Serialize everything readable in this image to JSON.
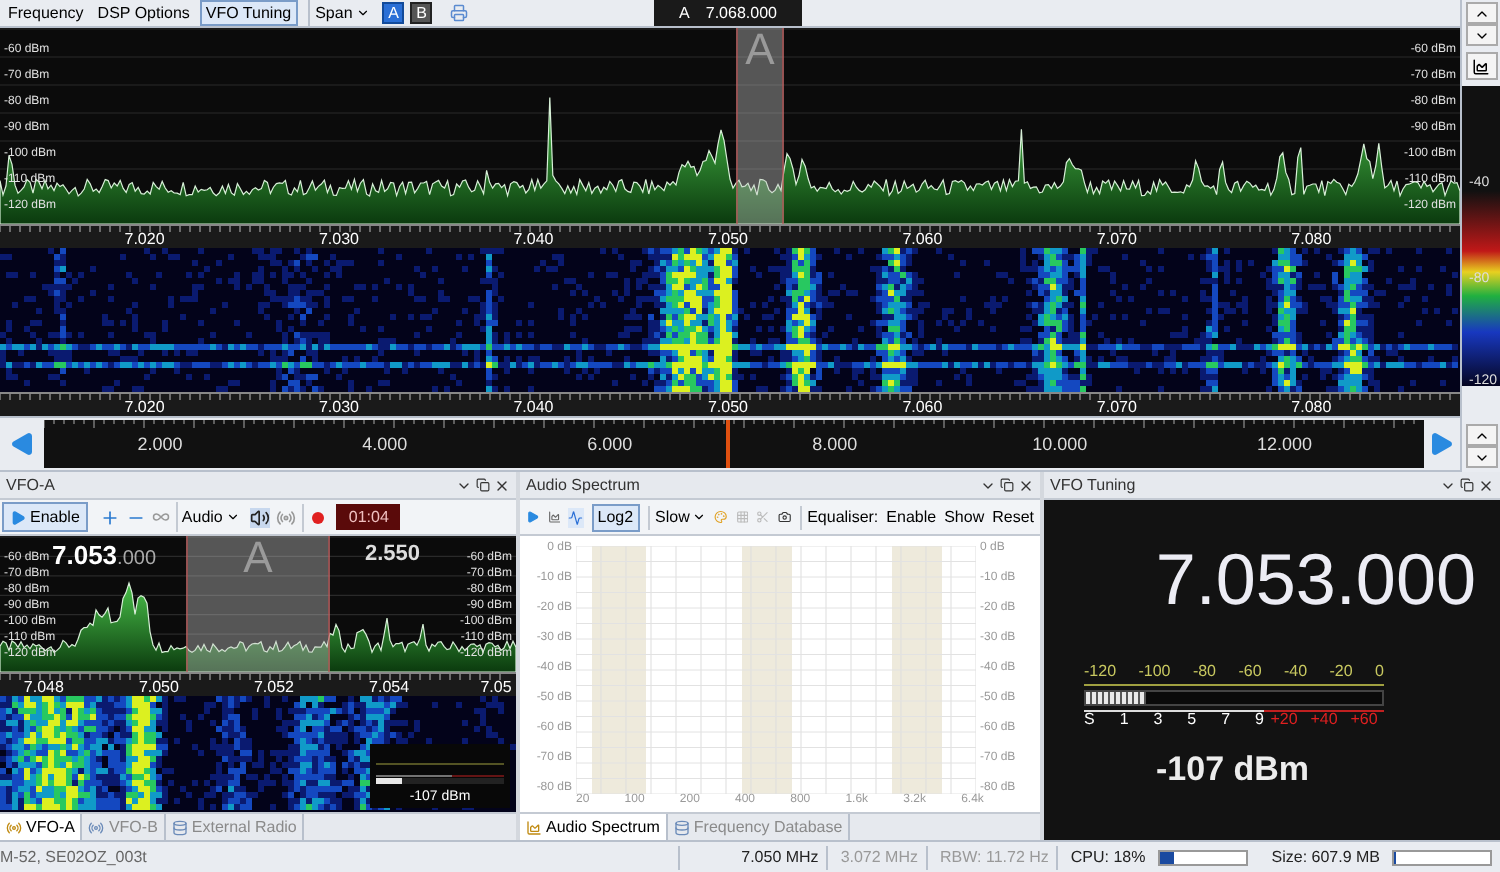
{
  "toolbar": {
    "tabs": [
      {
        "label": "Frequency",
        "selected": false
      },
      {
        "label": "DSP Options",
        "selected": false
      },
      {
        "label": "VFO Tuning",
        "selected": true
      }
    ],
    "span": "Span",
    "vfo_buttons": [
      {
        "label": "A",
        "selected": true
      },
      {
        "label": "B",
        "selected": false
      }
    ],
    "vfo_tab": {
      "vfo": "A",
      "frequency": "7.068.000"
    }
  },
  "spectrum": {
    "marker": "A",
    "dbm_left": [
      "-60 dBm",
      "-70 dBm",
      "-80 dBm",
      "-90 dBm",
      "-100 dBm",
      "-110 dBm",
      "-120 dBm"
    ],
    "dbm_right": [
      "-60 dBm",
      "-70 dBm",
      "-80 dBm",
      "-90 dBm",
      "-100 dBm",
      "-110 dBm",
      "-120 dBm"
    ],
    "freq_labels": [
      "7.020",
      "7.030",
      "7.040",
      "7.050",
      "7.060",
      "7.070",
      "7.080"
    ]
  },
  "waterfall": {
    "freq_labels": [
      "7.020",
      "7.030",
      "7.040",
      "7.050",
      "7.060",
      "7.070",
      "7.080"
    ]
  },
  "colour_scale": {
    "labels": [
      "-40",
      "-80",
      "-120"
    ]
  },
  "span_bar": {
    "labels": [
      "2.000",
      "4.000",
      "6.000",
      "8.000",
      "10.000",
      "12.000"
    ]
  },
  "vfo_a": {
    "title": "VFO-A",
    "enable": "Enable",
    "audio": "Audio",
    "timer": "01:04",
    "frequency": "7.053",
    "frequency_fraction": ".000",
    "bandwidth": "2.550",
    "marker": "A",
    "dbm_left": [
      "-60 dBm",
      "-70 dBm",
      "-80 dBm",
      "-90 dBm",
      "-100 dBm",
      "-110 dBm",
      "-120 dBm"
    ],
    "dbm_right": [
      "-60 dBm",
      "-70 dBm",
      "-80 dBm",
      "-90 dBm",
      "-100 dBm",
      "-110 dBm",
      "-120 dBm"
    ],
    "freq_labels": [
      "7.048",
      "7.050",
      "7.052",
      "7.054",
      "7.05"
    ],
    "meter": {
      "reading": "-107 dBm",
      "level": 0.2
    },
    "tabs": [
      {
        "label": "VFO-A",
        "selected": true
      },
      {
        "label": "VFO-B",
        "selected": false
      },
      {
        "label": "External Radio",
        "selected": false
      }
    ]
  },
  "audio_spectrum": {
    "title": "Audio Spectrum",
    "log": {
      "label": "Log2",
      "selected": true
    },
    "speed": "Slow",
    "equaliser": "Equaliser:",
    "actions": [
      "Enable",
      "Show",
      "Reset"
    ],
    "y_left": [
      "0 dB",
      "-10 dB",
      "-20 dB",
      "-30 dB",
      "-40 dB",
      "-50 dB",
      "-60 dB",
      "-70 dB",
      "-80 dB"
    ],
    "y_right": [
      "0 dB",
      "-10 dB",
      "-20 dB",
      "-30 dB",
      "-40 dB",
      "-50 dB",
      "-60 dB",
      "-70 dB",
      "-80 dB"
    ],
    "x_labels": [
      "20",
      "100",
      "200",
      "400",
      "800",
      "1.6k",
      "3.2k",
      "6.4k"
    ],
    "tabs": [
      {
        "label": "Audio Spectrum",
        "selected": true
      },
      {
        "label": "Frequency Database",
        "selected": false
      }
    ]
  },
  "vfo_tuning": {
    "title": "VFO Tuning",
    "frequency": "7.053.000",
    "dbm_scale": [
      "-120",
      "-100",
      "-80",
      "-60",
      "-40",
      "-20",
      "0"
    ],
    "s_scale": [
      "S",
      "1",
      "3",
      "5",
      "7",
      "9"
    ],
    "plus_scale": [
      "+20",
      "+40",
      "+60"
    ],
    "level": 0.2,
    "reading": "-107 dBm"
  },
  "status_bar": {
    "file": "M-52, SE02OZ_003t",
    "centre": "7.050 MHz",
    "span": "3.072 MHz",
    "rbw": "RBW: 11.72 Hz",
    "cpu": {
      "label": "CPU: 18%",
      "level": 0.18
    },
    "size": {
      "label": "Size: 607.9 MB",
      "level": 0.03
    }
  }
}
